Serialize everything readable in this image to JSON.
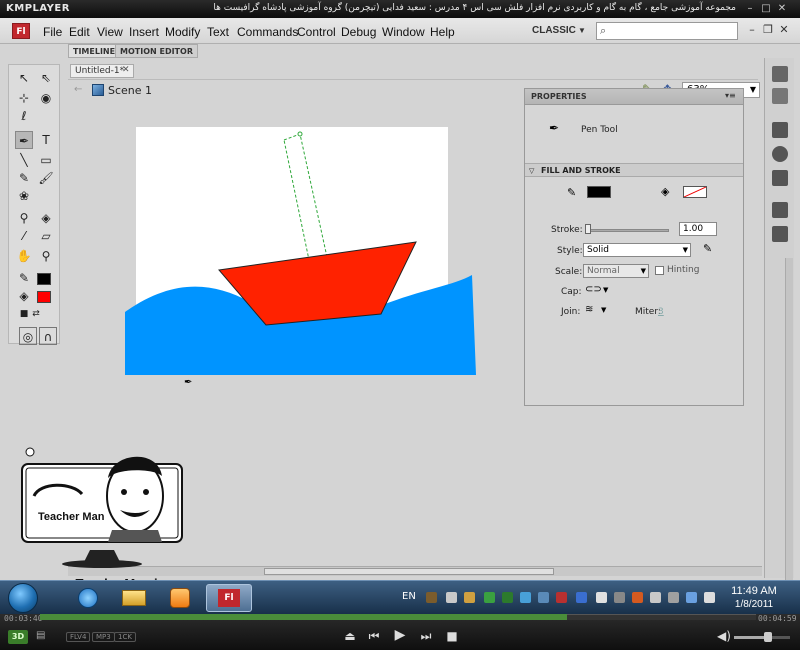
{
  "kmplayer": {
    "app_name": "KMPLAYER",
    "caption": "مجموعه آموزشی جامع ، گام به گام و کاربردی نرم افزار فلش سی اس ۴ مدرس : سعید فدایی (تیچرمن) گروه آموزشی پادشاه گرافیست ها"
  },
  "flash": {
    "logo": "Fl",
    "menu": [
      "File",
      "Edit",
      "View",
      "Insert",
      "Modify",
      "Text",
      "Commands",
      "Control",
      "Debug",
      "Window",
      "Help"
    ],
    "workspace": "CLASSIC",
    "panel_tabs": [
      "TIMELINE",
      "MOTION EDITOR"
    ],
    "document_tab": "Untitled-1*",
    "scene": "Scene 1",
    "zoom": "63%"
  },
  "properties": {
    "header": "PROPERTIES",
    "tool_name": "Pen Tool",
    "section": "FILL AND STROKE",
    "stroke_label": "Stroke:",
    "stroke_value": "1.00",
    "style_label": "Style:",
    "style_value": "Solid",
    "scale_label": "Scale:",
    "scale_value": "Normal",
    "hinting_label": "Hinting",
    "cap_label": "Cap:",
    "join_label": "Join:",
    "miter_label": "Miter:",
    "miter_value": "3"
  },
  "colors": {
    "stroke_color": "#000000",
    "fill_color": "#ff0000",
    "boat_hull": "#ff2200",
    "water": "#0094ff",
    "stage": "#ffffff"
  },
  "branding": {
    "site": "www.TeacherMan.ir",
    "logo_name": "Teacher Man"
  },
  "taskbar": {
    "language": "EN",
    "time": "11:49 AM",
    "date": "1/8/2011"
  },
  "player": {
    "current_time": "00:03:40",
    "total_time": "00:04:59",
    "badge": "3D",
    "tags": [
      "FLV4",
      "MP3",
      "1CK"
    ]
  }
}
